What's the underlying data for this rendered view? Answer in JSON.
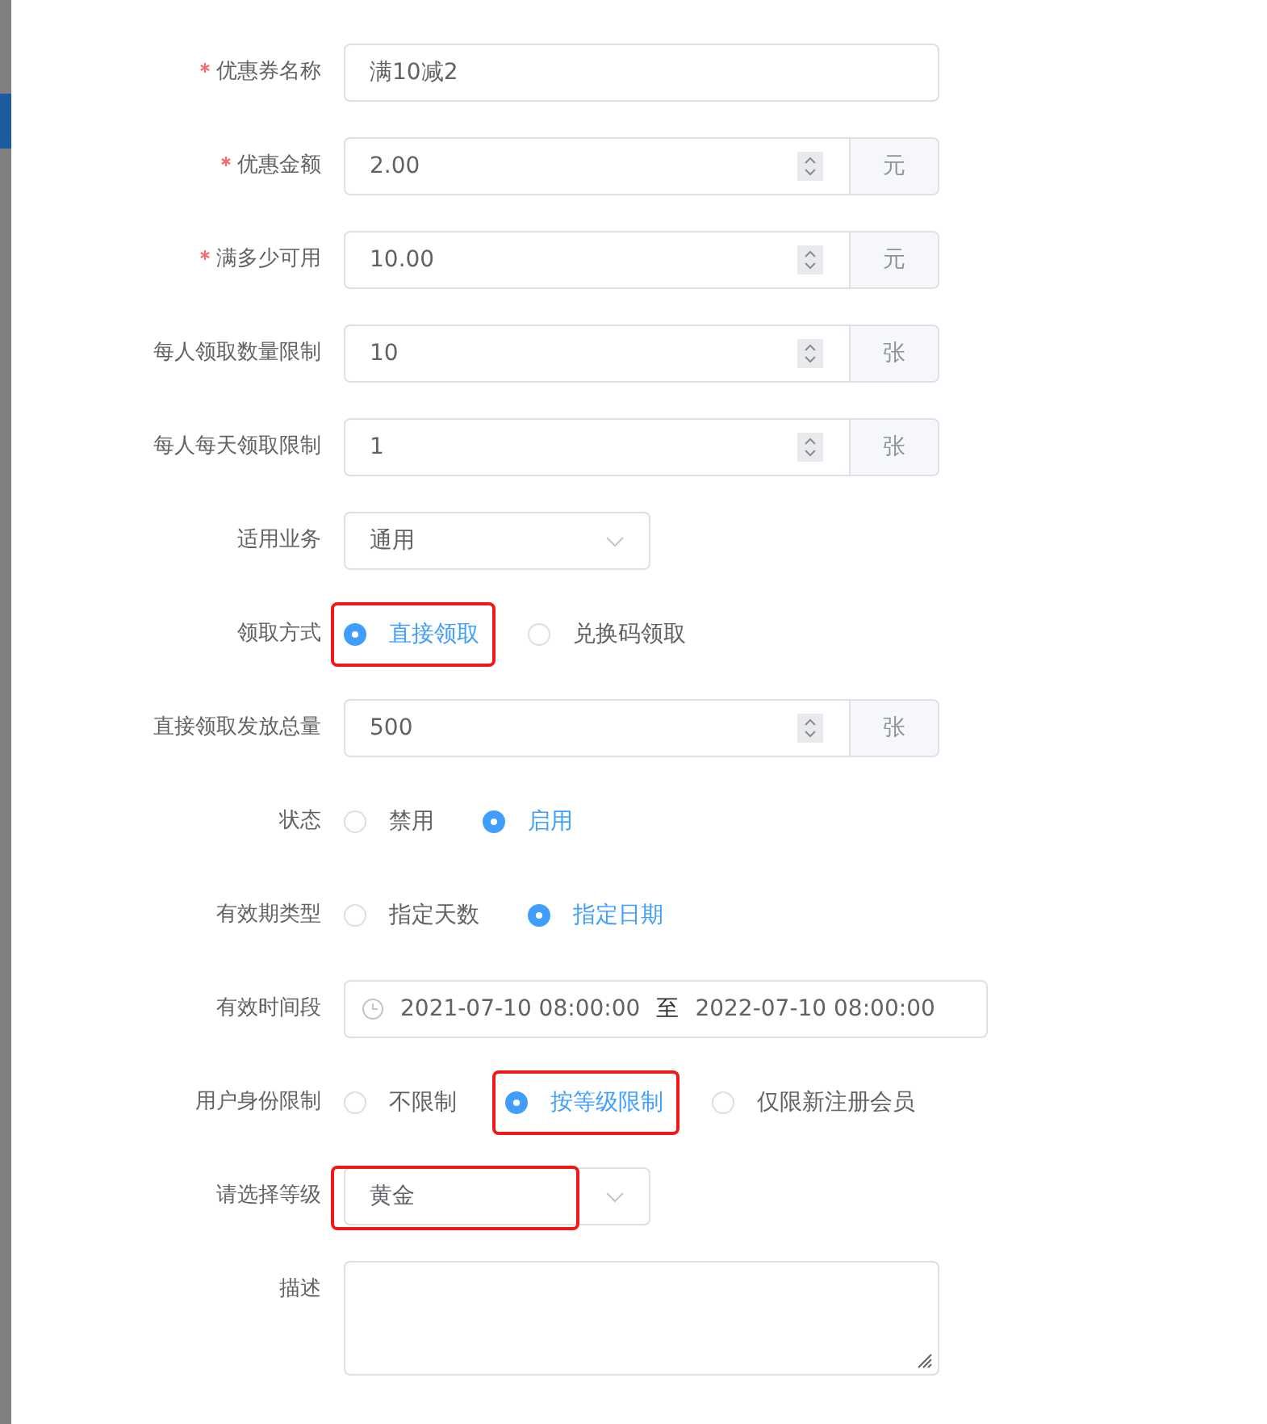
{
  "fields": [
    {
      "kind": "text",
      "label": "优惠券名称",
      "required": true,
      "value": "满10减2"
    },
    {
      "kind": "number",
      "label": "优惠金额",
      "required": true,
      "value": "2.00",
      "unit": "元"
    },
    {
      "kind": "number",
      "label": "满多少可用",
      "required": true,
      "value": "10.00",
      "unit": "元"
    },
    {
      "kind": "number",
      "label": "每人领取数量限制",
      "required": false,
      "value": "10",
      "unit": "张"
    },
    {
      "kind": "number",
      "label": "每人每天领取限制",
      "required": false,
      "value": "1",
      "unit": "张"
    },
    {
      "kind": "select",
      "label": "适用业务",
      "required": false,
      "value": "通用",
      "highlighted": false
    },
    {
      "kind": "radio",
      "label": "领取方式",
      "required": false,
      "options": [
        {
          "label": "直接领取",
          "selected": true,
          "highlighted": true
        },
        {
          "label": "兑换码领取",
          "selected": false,
          "highlighted": false
        }
      ]
    },
    {
      "kind": "number",
      "label": "直接领取发放总量",
      "required": false,
      "value": "500",
      "unit": "张"
    },
    {
      "kind": "radio",
      "label": "状态",
      "required": false,
      "options": [
        {
          "label": "禁用",
          "selected": false,
          "highlighted": false
        },
        {
          "label": "启用",
          "selected": true,
          "highlighted": false
        }
      ]
    },
    {
      "kind": "radio",
      "label": "有效期类型",
      "required": false,
      "options": [
        {
          "label": "指定天数",
          "selected": false,
          "highlighted": false
        },
        {
          "label": "指定日期",
          "selected": true,
          "highlighted": false
        }
      ]
    },
    {
      "kind": "daterange",
      "label": "有效时间段",
      "required": false,
      "start": "2021-07-10 08:00:00",
      "separator": "至",
      "end": "2022-07-10 08:00:00"
    },
    {
      "kind": "radio",
      "label": "用户身份限制",
      "required": false,
      "options": [
        {
          "label": "不限制",
          "selected": false,
          "highlighted": false
        },
        {
          "label": "按等级限制",
          "selected": true,
          "highlighted": true
        },
        {
          "label": "仅限新注册会员",
          "selected": false,
          "highlighted": false
        }
      ]
    },
    {
      "kind": "select",
      "label": "请选择等级",
      "required": false,
      "value": "黄金",
      "highlighted": true
    },
    {
      "kind": "textarea",
      "label": "描述",
      "required": false
    }
  ]
}
